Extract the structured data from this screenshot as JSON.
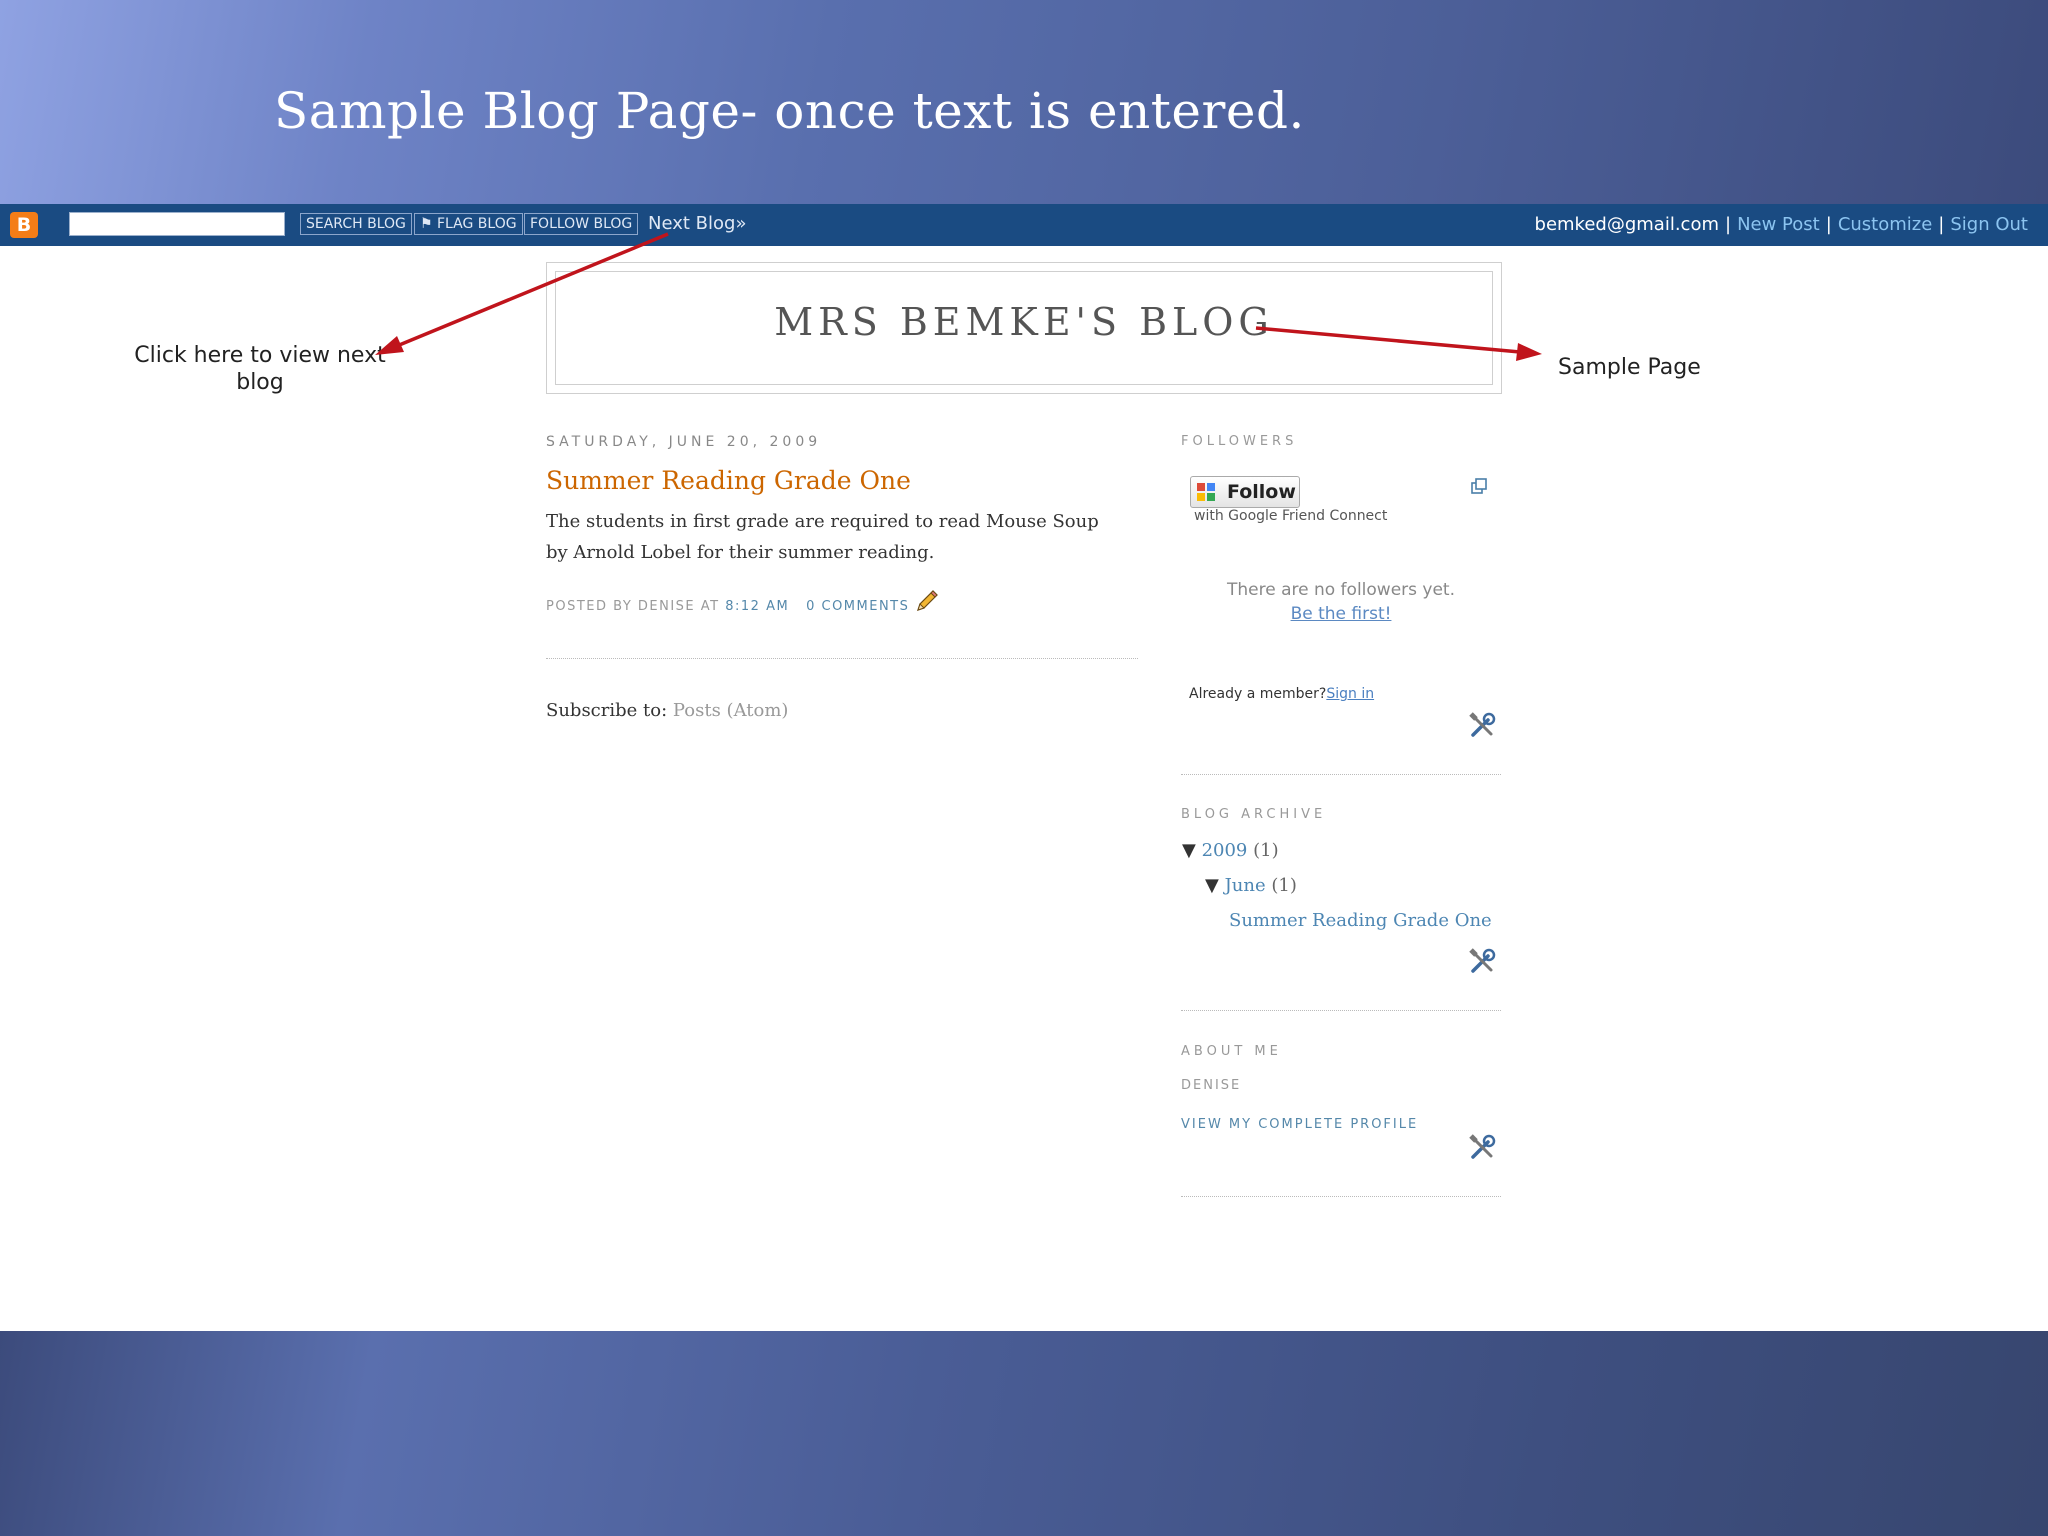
{
  "slide": {
    "title": "Sample Blog Page- once text is entered."
  },
  "navbar": {
    "logo": "B",
    "search_button": "SEARCH BLOG",
    "flag_button": "⚑ FLAG BLOG",
    "follow_button": "FOLLOW BLOG",
    "next_blog": "Next Blog»",
    "user_email": "bemked@gmail.com",
    "new_post": "New Post",
    "customize": "Customize",
    "sign_out": "Sign Out",
    "separator": "|"
  },
  "annotations": {
    "next_blog_note": "Click here to view next blog",
    "sample_page_note": "Sample Page",
    "arrow_color": "#c0141c"
  },
  "blog": {
    "title": "MRS BEMKE'S BLOG"
  },
  "post": {
    "date": "SATURDAY, JUNE 20, 2009",
    "title": "Summer Reading Grade One",
    "body": "The students in first grade are required to read Mouse Soup by Arnold Lobel for their summer reading.",
    "posted_by": "POSTED BY DENISE AT",
    "time": "8:12 AM",
    "comments": "0 COMMENTS",
    "edit_icon": "pencil-icon"
  },
  "subscribe": {
    "label": "Subscribe to:",
    "link": "Posts (Atom)"
  },
  "sidebar": {
    "followers": {
      "heading": "FOLLOWERS",
      "follow_button": "Follow",
      "gfc_note": "with Google Friend Connect",
      "no_followers": "There are no followers yet.",
      "be_first": "Be the first!",
      "already_member": "Already a member?",
      "sign_in": "Sign in"
    },
    "archive": {
      "heading": "BLOG ARCHIVE",
      "year": "2009",
      "year_count": "(1)",
      "month": "June",
      "month_count": "(1)",
      "post_link": "Summer Reading Grade One",
      "toggle": "▼"
    },
    "about": {
      "heading": "ABOUT ME",
      "name": "DENISE",
      "profile_link": "VIEW MY COMPLETE PROFILE"
    }
  }
}
